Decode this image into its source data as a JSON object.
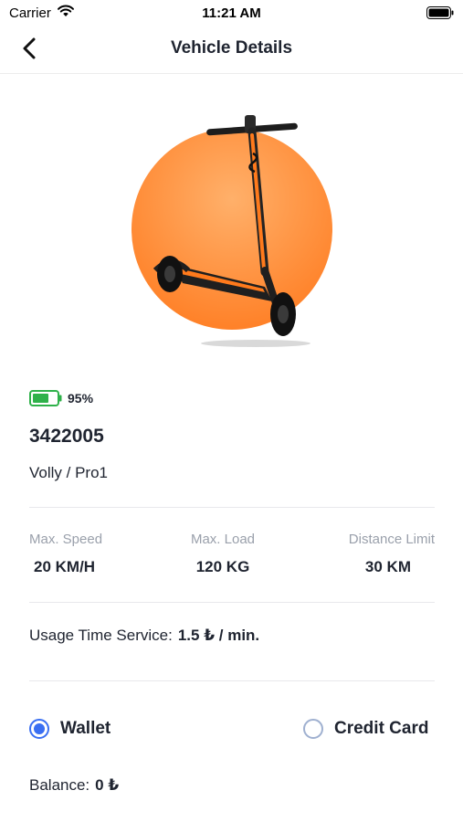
{
  "status_bar": {
    "carrier": "Carrier",
    "time": "11:21 AM"
  },
  "nav": {
    "title": "Vehicle Details"
  },
  "vehicle": {
    "battery_percent": "95%",
    "id": "3422005",
    "model": "Volly / Pro1",
    "accent_color": "#ff8a2b"
  },
  "specs": [
    {
      "label": "Max. Speed",
      "value": "20 KM/H"
    },
    {
      "label": "Max. Load",
      "value": "120 KG"
    },
    {
      "label": "Distance Limit",
      "value": "30 KM"
    }
  ],
  "usage": {
    "label": "Usage Time Service:",
    "value": "1.5 ₺ / min."
  },
  "payment": {
    "options": [
      {
        "label": "Wallet",
        "selected": true
      },
      {
        "label": "Credit Card",
        "selected": false
      }
    ]
  },
  "balance": {
    "label": "Balance:",
    "value": "0 ₺"
  },
  "colors": {
    "primary": "#3a6ff2",
    "battery": "#2fb14a"
  }
}
